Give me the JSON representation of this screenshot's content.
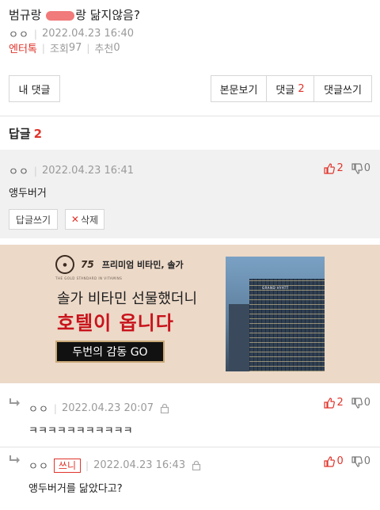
{
  "post": {
    "title_before": "범규랑",
    "title_after": "랑 닮지않음?",
    "author": "ㅇㅇ",
    "datetime": "2022.04.23 16:40",
    "category": "엔터톡",
    "views_label": "조회",
    "views": "97",
    "recommend_label": "추천",
    "recommend": "0"
  },
  "toolbar": {
    "my_comments": "내 댓글",
    "view_body": "본문보기",
    "comments_label": "댓글",
    "comments_count": "2",
    "write_comment": "댓글쓰기"
  },
  "replies": {
    "label": "답글",
    "count": "2"
  },
  "comments": [
    {
      "author": "ㅇㅇ",
      "datetime": "2022.04.23 16:41",
      "text": "앵두버거",
      "up": "2",
      "down": "0",
      "reply_label": "답글쓰기",
      "delete_label": "삭제"
    },
    {
      "author": "ㅇㅇ",
      "datetime": "2022.04.23 20:07",
      "text": "ㅋㅋㅋㅋㅋㅋㅋㅋㅋㅋㅋ",
      "up": "2",
      "down": "0"
    },
    {
      "author": "ㅇㅇ",
      "badge": "쓰니",
      "datetime": "2022.04.23 16:43",
      "text": "앵두버거를 닮았다고?",
      "up": "0",
      "down": "0"
    }
  ],
  "ad": {
    "brand_number": "75",
    "brand_tag": "프리미엄 비타민, 솔가",
    "sub": "THE GOLD STANDARD IN VITAMINS",
    "line1": "솔가 비타민 선물했더니",
    "line2": "호텔이 옵니다",
    "cta": "두번의 감동 GO",
    "sign": "GRAND HYATT"
  },
  "colors": {
    "accent": "#e0342b",
    "ad_background": "#ecd9c8",
    "comment_background": "#f1f1f1"
  },
  "icons": {
    "thumb_up": "thumbs-up-icon",
    "thumb_down": "thumbs-down-icon",
    "reply_arrow": "reply-arrow-icon",
    "lock": "lock-icon",
    "close": "x-icon"
  }
}
